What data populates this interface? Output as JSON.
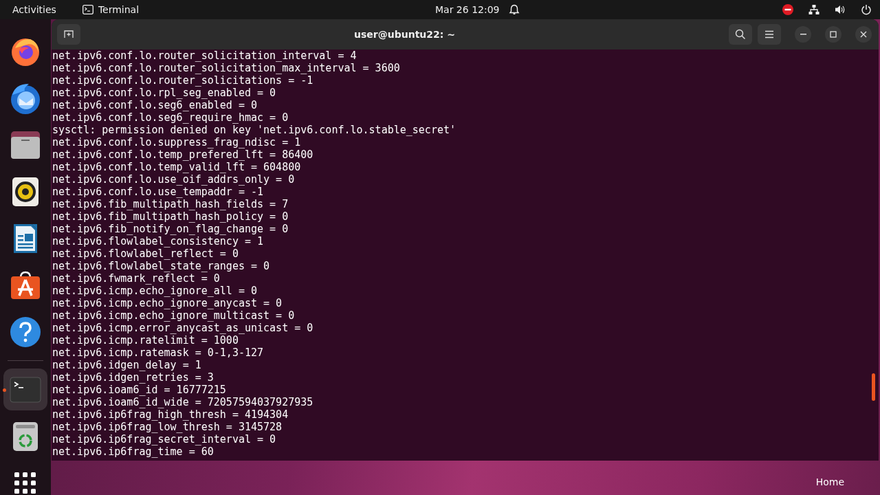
{
  "top_bar": {
    "activities": "Activities",
    "app_name": "Terminal",
    "date": "Mar 26",
    "time": "12:09"
  },
  "dock": [
    {
      "kind": "firefox",
      "selected": false
    },
    {
      "kind": "thunderbird",
      "selected": false
    },
    {
      "kind": "files",
      "selected": false
    },
    {
      "kind": "rhythmbox",
      "selected": false
    },
    {
      "kind": "writer",
      "selected": false
    },
    {
      "kind": "appcenter",
      "selected": false
    },
    {
      "kind": "help",
      "selected": false
    },
    {
      "kind": "separator"
    },
    {
      "kind": "terminal",
      "selected": true
    },
    {
      "kind": "trash",
      "selected": false
    },
    {
      "kind": "apps",
      "selected": false
    }
  ],
  "window": {
    "title": "user@ubuntu22: ~"
  },
  "terminal_lines": [
    "net.ipv6.conf.lo.router_solicitation_interval = 4",
    "net.ipv6.conf.lo.router_solicitation_max_interval = 3600",
    "net.ipv6.conf.lo.router_solicitations = -1",
    "net.ipv6.conf.lo.rpl_seg_enabled = 0",
    "net.ipv6.conf.lo.seg6_enabled = 0",
    "net.ipv6.conf.lo.seg6_require_hmac = 0",
    "sysctl: permission denied on key 'net.ipv6.conf.lo.stable_secret'",
    "net.ipv6.conf.lo.suppress_frag_ndisc = 1",
    "net.ipv6.conf.lo.temp_prefered_lft = 86400",
    "net.ipv6.conf.lo.temp_valid_lft = 604800",
    "net.ipv6.conf.lo.use_oif_addrs_only = 0",
    "net.ipv6.conf.lo.use_tempaddr = -1",
    "net.ipv6.fib_multipath_hash_fields = 7",
    "net.ipv6.fib_multipath_hash_policy = 0",
    "net.ipv6.fib_notify_on_flag_change = 0",
    "net.ipv6.flowlabel_consistency = 1",
    "net.ipv6.flowlabel_reflect = 0",
    "net.ipv6.flowlabel_state_ranges = 0",
    "net.ipv6.fwmark_reflect = 0",
    "net.ipv6.icmp.echo_ignore_all = 0",
    "net.ipv6.icmp.echo_ignore_anycast = 0",
    "net.ipv6.icmp.echo_ignore_multicast = 0",
    "net.ipv6.icmp.error_anycast_as_unicast = 0",
    "net.ipv6.icmp.ratelimit = 1000",
    "net.ipv6.icmp.ratemask = 0-1,3-127",
    "net.ipv6.idgen_delay = 1",
    "net.ipv6.idgen_retries = 3",
    "net.ipv6.ioam6_id = 16777215",
    "net.ipv6.ioam6_id_wide = 72057594037927935",
    "net.ipv6.ip6frag_high_thresh = 4194304",
    "net.ipv6.ip6frag_low_thresh = 3145728",
    "net.ipv6.ip6frag_secret_interval = 0",
    "net.ipv6.ip6frag_time = 60"
  ],
  "desktop": [
    {
      "label": "Home"
    }
  ]
}
